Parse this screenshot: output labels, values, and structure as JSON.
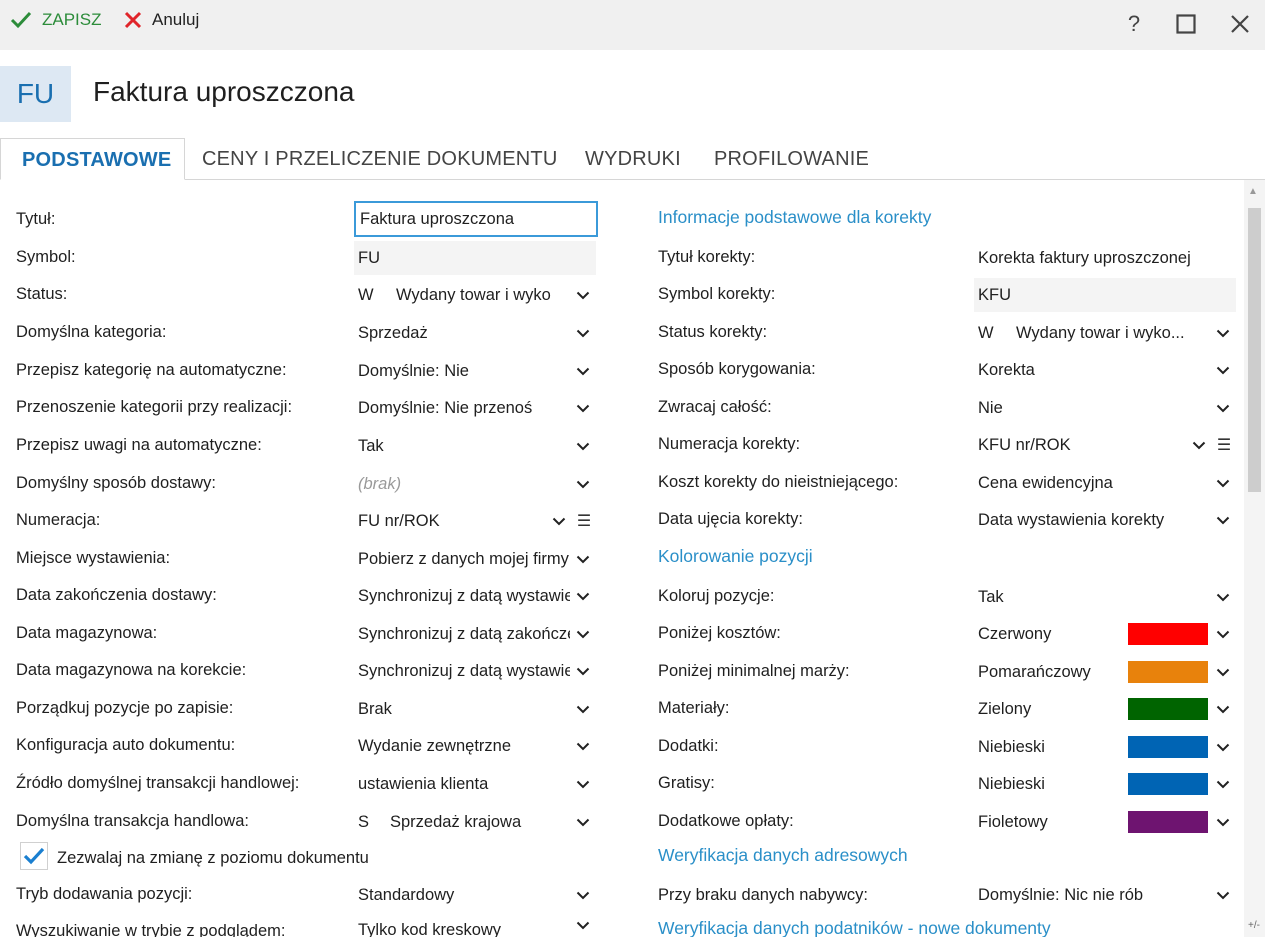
{
  "toolbar": {
    "save_label": "ZAPISZ",
    "cancel_label": "Anuluj",
    "help_label": "?"
  },
  "header": {
    "badge": "FU",
    "title": "Faktura uproszczona"
  },
  "tabs": [
    {
      "label": "PODSTAWOWE"
    },
    {
      "label": "CENY I PRZELICZENIE DOKUMENTU"
    },
    {
      "label": "WYDRUKI"
    },
    {
      "label": "PROFILOWANIE"
    }
  ],
  "left": {
    "rows": [
      {
        "label": "Tytuł:",
        "value": "Faktura uproszczona"
      },
      {
        "label": "Symbol:",
        "value": "FU"
      },
      {
        "label": "Status:",
        "code": "W",
        "value": "Wydany towar i wyko"
      },
      {
        "label": "Domyślna kategoria:",
        "value": "Sprzedaż"
      },
      {
        "label": "Przepisz kategorię na automatyczne:",
        "value": "Domyślnie: Nie"
      },
      {
        "label": "Przenoszenie kategorii przy realizacji:",
        "value": "Domyślnie: Nie przenoś"
      },
      {
        "label": "Przepisz uwagi na automatyczne:",
        "value": "Tak"
      },
      {
        "label": "Domyślny sposób dostawy:",
        "value": "(brak)"
      },
      {
        "label": "Numeracja:",
        "value": "FU nr/ROK"
      },
      {
        "label": "Miejsce wystawienia:",
        "value": "Pobierz z danych mojej firmy"
      },
      {
        "label": "Data zakończenia dostawy:",
        "value": "Synchronizuj z datą wystawienia"
      },
      {
        "label": "Data magazynowa:",
        "value": "Synchronizuj z datą zakończenia"
      },
      {
        "label": "Data magazynowa na korekcie:",
        "value": "Synchronizuj z datą wystawienia"
      },
      {
        "label": "Porządkuj pozycje po zapisie:",
        "value": "Brak"
      },
      {
        "label": "Konfiguracja auto dokumentu:",
        "value": "Wydanie zewnętrzne"
      },
      {
        "label": "Źródło domyślnej transakcji handlowej:",
        "value": "ustawienia klienta"
      },
      {
        "label": "Domyślna transakcja handlowa:",
        "code": "S",
        "value": "Sprzedaż krajowa"
      },
      {
        "label": "Tryb dodawania pozycji:",
        "value": "Standardowy"
      },
      {
        "label": "Wyszukiwanie w trybie z podglądem:",
        "value": "Tylko kod kreskowy"
      }
    ],
    "checkbox_label": "Zezwalaj na zmianę z poziomu dokumentu"
  },
  "right": {
    "sections": {
      "korekta": "Informacje podstawowe dla korekty",
      "kolorowanie": "Kolorowanie pozycji",
      "adresowe": "Weryfikacja danych adresowych",
      "podatnikow": "Weryfikacja danych podatników - nowe dokumenty"
    },
    "rows": [
      {
        "label": "Tytuł korekty:",
        "value": "Korekta faktury uproszczonej"
      },
      {
        "label": "Symbol korekty:",
        "value": "KFU"
      },
      {
        "label": "Status korekty:",
        "code": "W",
        "value": "Wydany towar i wyko..."
      },
      {
        "label": "Sposób korygowania:",
        "value": "Korekta"
      },
      {
        "label": "Zwracaj całość:",
        "value": "Nie"
      },
      {
        "label": "Numeracja korekty:",
        "value": "KFU nr/ROK"
      },
      {
        "label": "Koszt korekty do nieistniejącego:",
        "value": "Cena ewidencyjna"
      },
      {
        "label": "Data ujęcia korekty:",
        "value": "Data wystawienia korekty"
      },
      {
        "label": "Koloruj pozycje:",
        "value": "Tak"
      },
      {
        "label": "Poniżej kosztów:",
        "value": "Czerwony",
        "color": "#ff0000"
      },
      {
        "label": "Poniżej minimalnej marży:",
        "value": "Pomarańczowy",
        "color": "#e8820c"
      },
      {
        "label": "Materiały:",
        "value": "Zielony",
        "color": "#006400"
      },
      {
        "label": "Dodatki:",
        "value": "Niebieski",
        "color": "#0064b4"
      },
      {
        "label": "Gratisy:",
        "value": "Niebieski",
        "color": "#0064b4"
      },
      {
        "label": "Dodatkowe opłaty:",
        "value": "Fioletowy",
        "color": "#6e1470"
      },
      {
        "label": "Przy braku danych nabywcy:",
        "value": "Domyślnie: Nic nie rób"
      }
    ]
  },
  "scroll_corner": "+/-",
  "colors": {
    "accent": "#1a6fb0",
    "save_green": "#2c8c3a",
    "cancel_red": "#e0242a",
    "section_blue": "#2a8fc8"
  }
}
